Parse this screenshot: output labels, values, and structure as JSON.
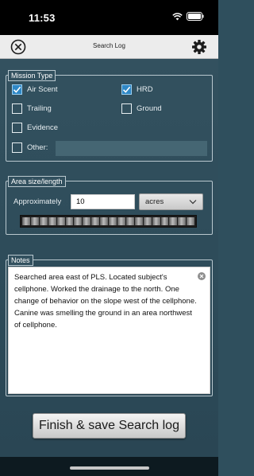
{
  "status": {
    "time": "11:53"
  },
  "nav": {
    "title": "Search Log"
  },
  "mission": {
    "legend": "Mission Type",
    "options": [
      {
        "label": "Air Scent",
        "checked": true
      },
      {
        "label": "HRD",
        "checked": true
      },
      {
        "label": "Trailing",
        "checked": false
      },
      {
        "label": "Ground",
        "checked": false
      },
      {
        "label": "Evidence",
        "checked": false
      },
      {
        "label": "Other:",
        "checked": false
      }
    ],
    "other_value": ""
  },
  "area": {
    "legend": "Area size/length",
    "label": "Approximately",
    "value": "10",
    "unit": "acres"
  },
  "notes": {
    "legend": "Notes",
    "text": "Searched area east of PLS. Located subject's cellphone. Worked the drainage to the north. One change of behavior on the slope west of the cellphone.  Canine was smelling the ground in an area northwest of cellphone."
  },
  "finish": {
    "label": "Finish & save Search log"
  },
  "colors": {
    "background": "#2f4f5d",
    "checkbox_checked": "#2f88c6"
  }
}
